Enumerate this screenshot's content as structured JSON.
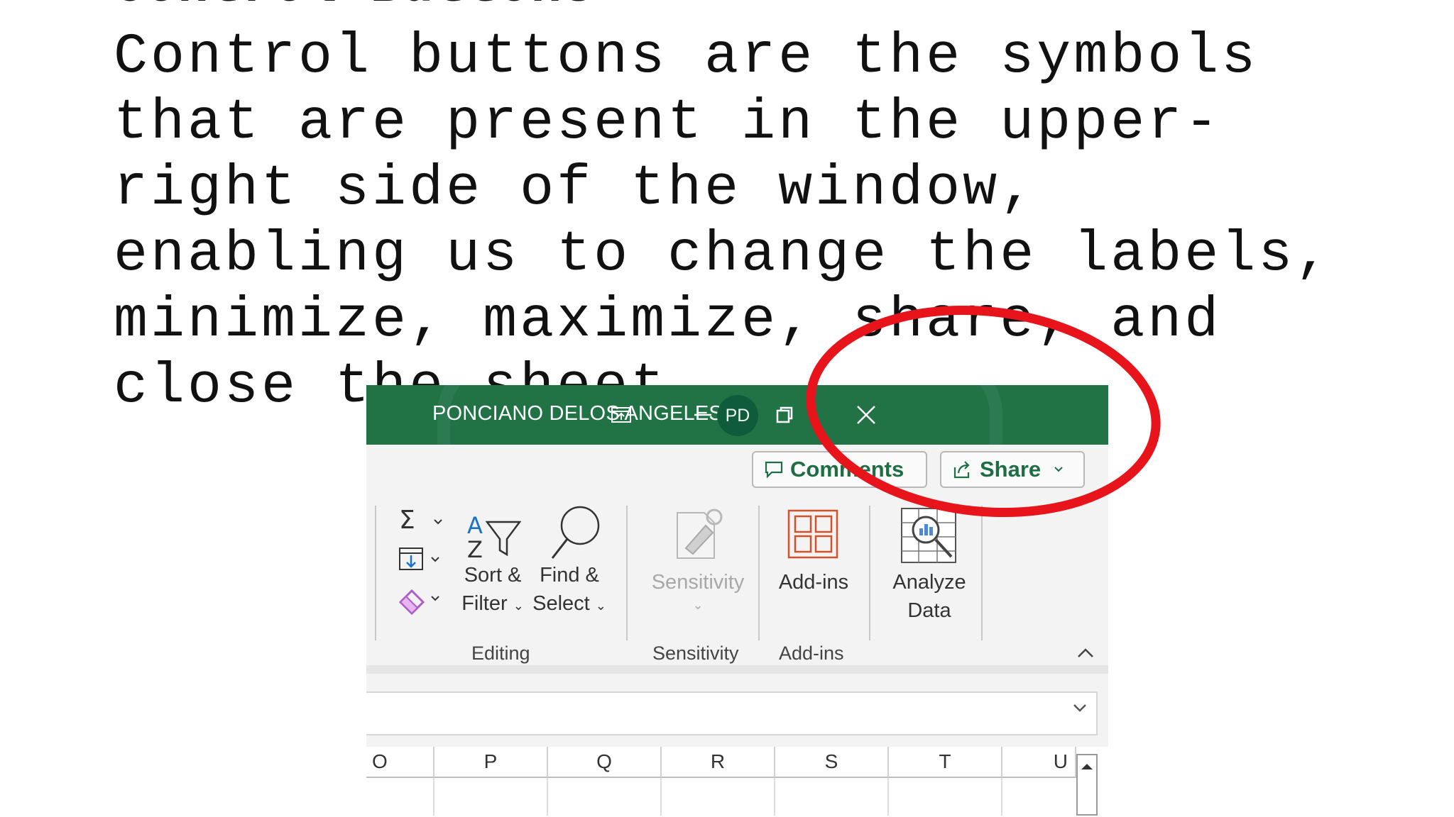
{
  "slide": {
    "heading": "Control Buttons",
    "body": "Control buttons are the symbols\nthat are present in the upper-\nright side of the window,\nenabling us to change the labels,\nminimize, maximize, share, and\nclose the sheet."
  },
  "excel": {
    "titlebar": {
      "user_name": "PONCIANO DELOS ANGELES",
      "avatar_initials": "PD",
      "accent": "#217346"
    },
    "actions": {
      "comments_label": "Comments",
      "share_label": "Share"
    },
    "ribbon": {
      "editing": {
        "sort_filter_line1": "Sort &",
        "sort_filter_line2": "Filter",
        "find_select_line1": "Find &",
        "find_select_line2": "Select",
        "group_label": "Editing"
      },
      "sensitivity": {
        "button_label": "Sensitivity",
        "group_label": "Sensitivity"
      },
      "addins": {
        "button_label": "Add-ins",
        "group_label": "Add-ins"
      },
      "analyze": {
        "line1": "Analyze",
        "line2": "Data"
      }
    },
    "columns": [
      "O",
      "P",
      "Q",
      "R",
      "S",
      "T",
      "U"
    ]
  },
  "annotation": {
    "highlight_color": "#e8141c"
  }
}
